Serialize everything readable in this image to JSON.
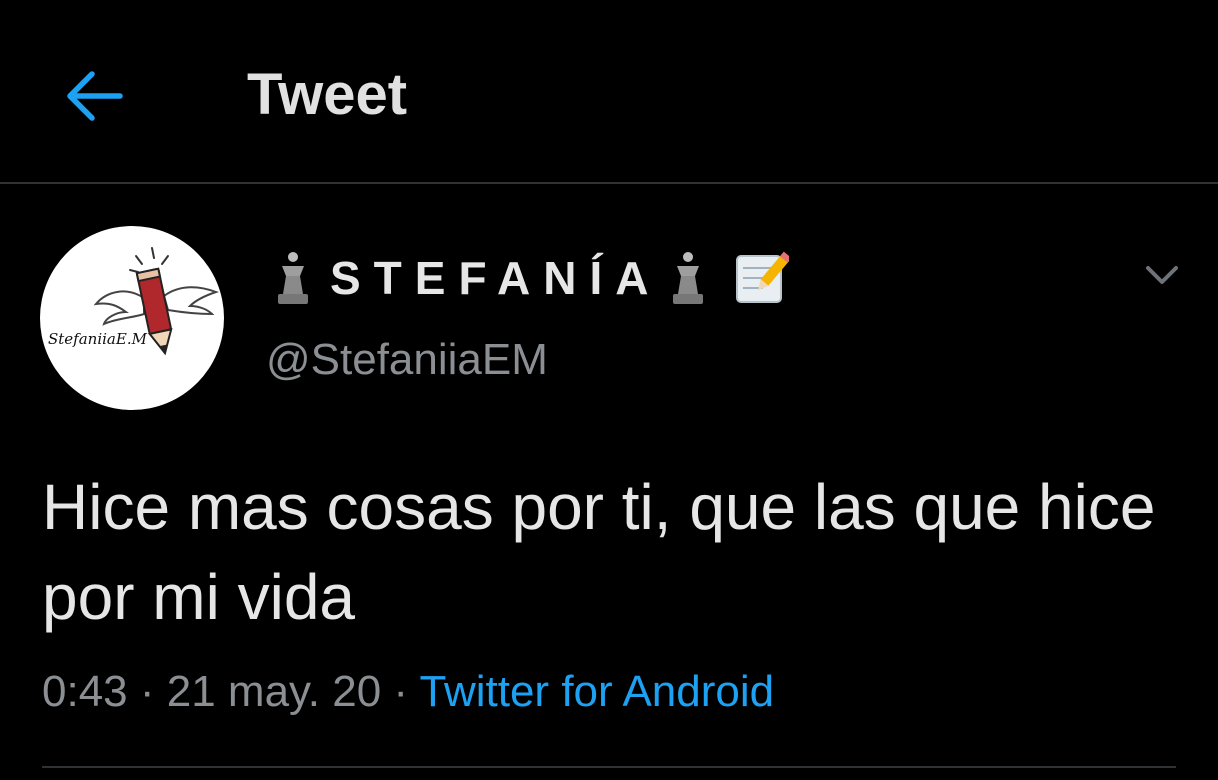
{
  "header": {
    "back_icon": "arrow-left-icon",
    "title": "Tweet"
  },
  "tweet": {
    "avatar": {
      "icon": "pencil-with-wings-logo",
      "logo_text": "StefaniiaE.M"
    },
    "display_name": "STEFANÍA",
    "display_name_icons": [
      "chess-queen-icon",
      "chess-queen-icon",
      "memo-icon"
    ],
    "handle": "@StefaniiaEM",
    "menu_icon": "chevron-down-icon",
    "text": "Hice mas cosas por ti, que las que hice por mi vida",
    "time": "0:43",
    "separator": "·",
    "date": "21 may. 20",
    "source": "Twitter for Android"
  },
  "colors": {
    "background": "#000000",
    "accent": "#1da1f2",
    "secondary_text": "#8b8f93",
    "primary_text": "#e6e6e6",
    "divider": "#2f3336"
  }
}
